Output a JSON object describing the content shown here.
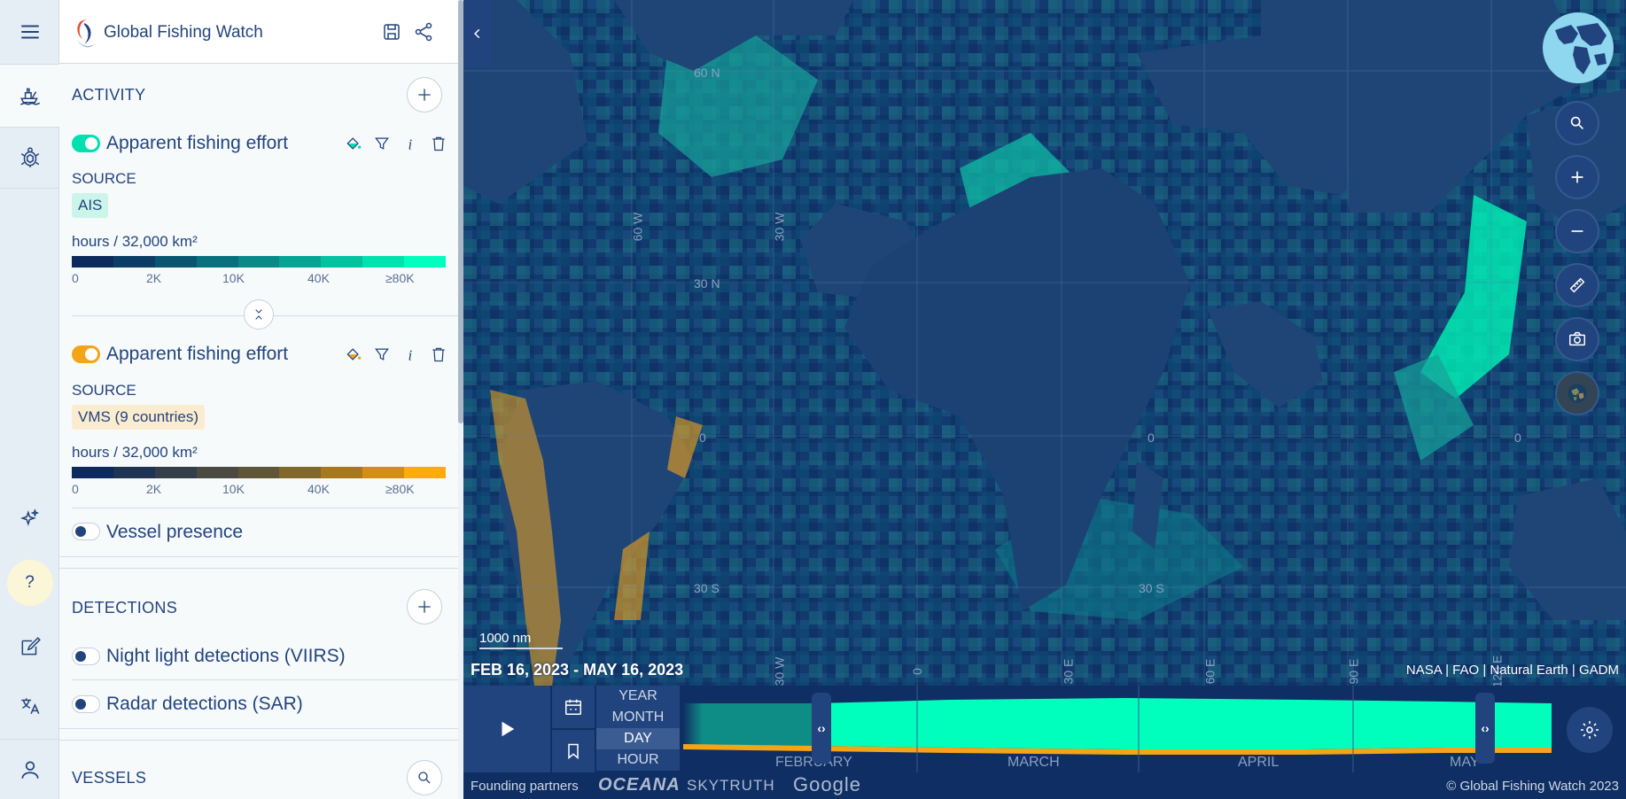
{
  "app": {
    "title": "Global Fishing Watch"
  },
  "rail": {
    "items": [
      {
        "icon": "menu-icon"
      },
      {
        "icon": "vessel-icon"
      },
      {
        "icon": "turtle-icon"
      },
      {
        "icon": "sparkle-icon"
      },
      {
        "icon": "help-icon",
        "label": "?"
      },
      {
        "icon": "feedback-icon"
      },
      {
        "icon": "translate-icon"
      },
      {
        "icon": "user-icon"
      }
    ]
  },
  "activity": {
    "title": "ACTIVITY",
    "layers": [
      {
        "name": "Apparent fishing effort",
        "enabled": true,
        "color": "#00FFBC",
        "source_label": "SOURCE",
        "source": "AIS",
        "unit": "hours / 32,000 km²",
        "ticks": [
          "0",
          "2K",
          "10K",
          "40K",
          "≥80K"
        ]
      },
      {
        "name": "Apparent fishing effort",
        "enabled": true,
        "color": "#FFAA0D",
        "source_label": "SOURCE",
        "source": "VMS (9 countries)",
        "unit": "hours / 32,000 km²",
        "ticks": [
          "0",
          "2K",
          "10K",
          "40K",
          "≥80K"
        ]
      }
    ],
    "extra": [
      {
        "name": "Vessel presence",
        "enabled": false
      }
    ]
  },
  "detections": {
    "title": "DETECTIONS",
    "layers": [
      {
        "name": "Night light detections (VIIRS)",
        "enabled": false
      },
      {
        "name": "Radar detections (SAR)",
        "enabled": false
      }
    ]
  },
  "vessels": {
    "title": "VESSELS"
  },
  "map": {
    "scale": "1000 nm",
    "date_range": "FEB 16, 2023 - MAY 16, 2023",
    "attribution": "NASA | FAO | Natural Earth | GADM",
    "graticule": {
      "lat": [
        "60 N",
        "30 N",
        "0",
        "30 S",
        "0",
        "30 S",
        "0"
      ],
      "lon": [
        "60 W",
        "30 W",
        "30 W",
        "0",
        "30 E",
        "60 E",
        "90 E",
        "120 E"
      ]
    }
  },
  "timebar": {
    "intervals": [
      "YEAR",
      "MONTH",
      "DAY",
      "HOUR"
    ],
    "active_interval": "DAY",
    "months": [
      "FEBRUARY",
      "MARCH",
      "APRIL",
      "MAY"
    ]
  },
  "footer": {
    "partners": "Founding partners",
    "brands": [
      "OCEANA",
      "SKYTRUTH",
      "Google"
    ],
    "copyright": "© Global Fishing Watch 2023"
  }
}
